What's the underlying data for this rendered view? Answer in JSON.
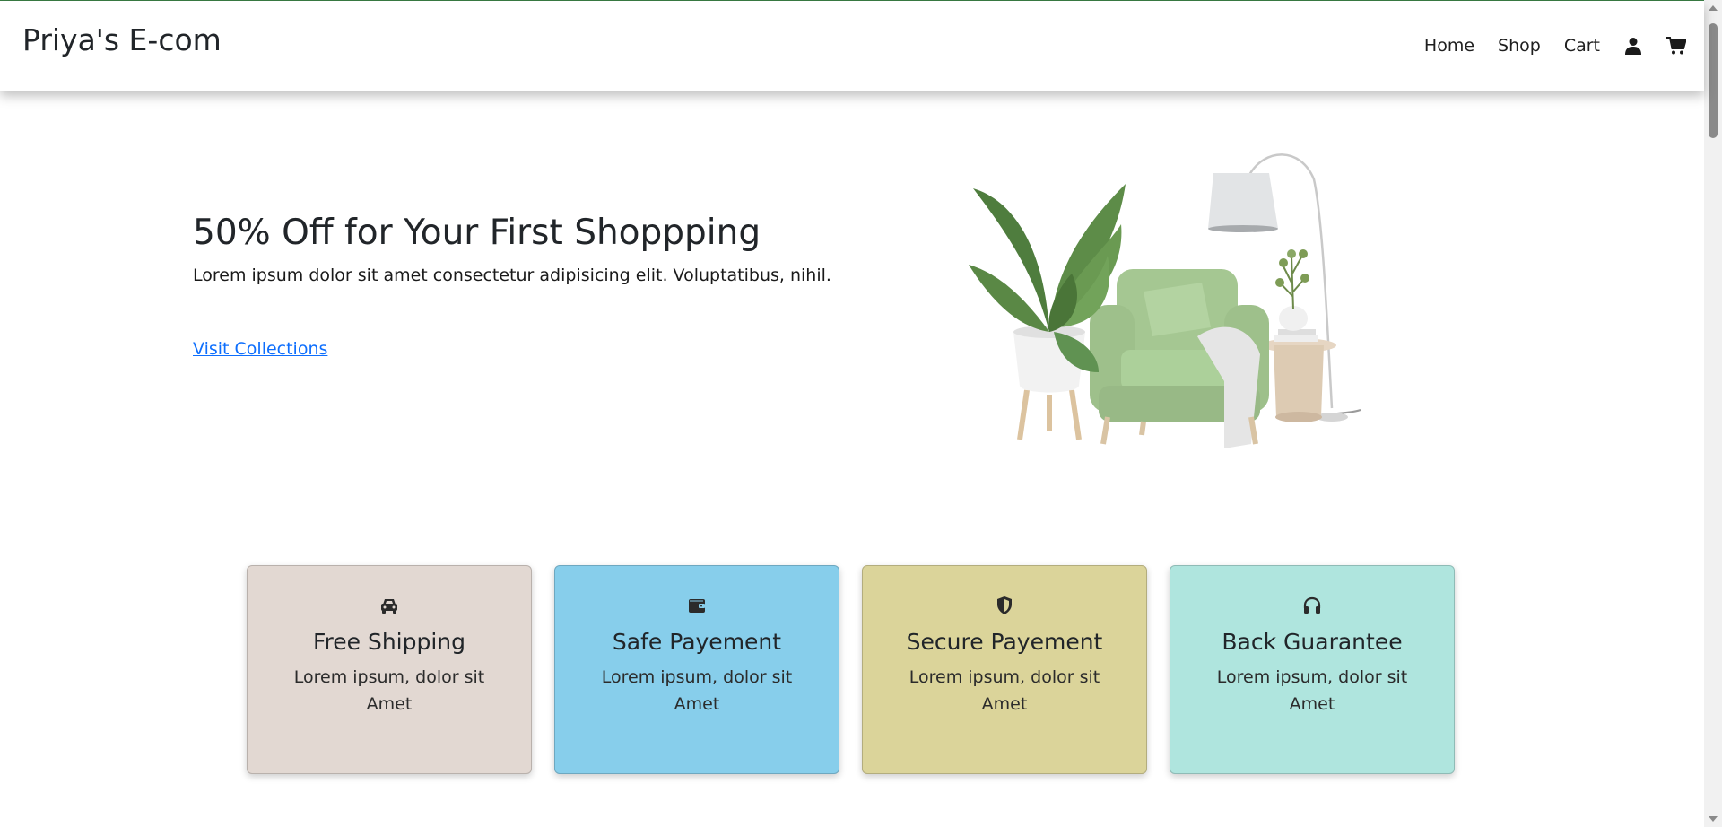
{
  "navbar": {
    "brand": "Priya's E-com",
    "links": [
      "Home",
      "Shop",
      "Cart"
    ],
    "icons": [
      "user-icon",
      "cart-icon"
    ]
  },
  "hero": {
    "title": "50% Off for Your First Shoppping",
    "subtitle": "Lorem ipsum dolor sit amet consectetur adipisicing elit. Voluptatibus, nihil.",
    "link": "Visit Collections",
    "image": "living-room-armchair-plant-lamp-image"
  },
  "features": [
    {
      "icon": "car-icon",
      "title": "Free Shipping",
      "text": "Lorem ipsum, dolor sit Amet",
      "color": "#e2d8d2"
    },
    {
      "icon": "wallet-icon",
      "title": "Safe Payement",
      "text": "Lorem ipsum, dolor sit Amet",
      "color": "#87ceeb"
    },
    {
      "icon": "shield-icon",
      "title": "Secure Payement",
      "text": "Lorem ipsum, dolor sit Amet",
      "color": "#dbd49a"
    },
    {
      "icon": "headphones-icon",
      "title": "Back Guarantee",
      "text": "Lorem ipsum, dolor sit Amet",
      "color": "#afe5de"
    }
  ],
  "colors": {
    "accent_link": "#0d6efd",
    "topline": "#3a7d44"
  }
}
